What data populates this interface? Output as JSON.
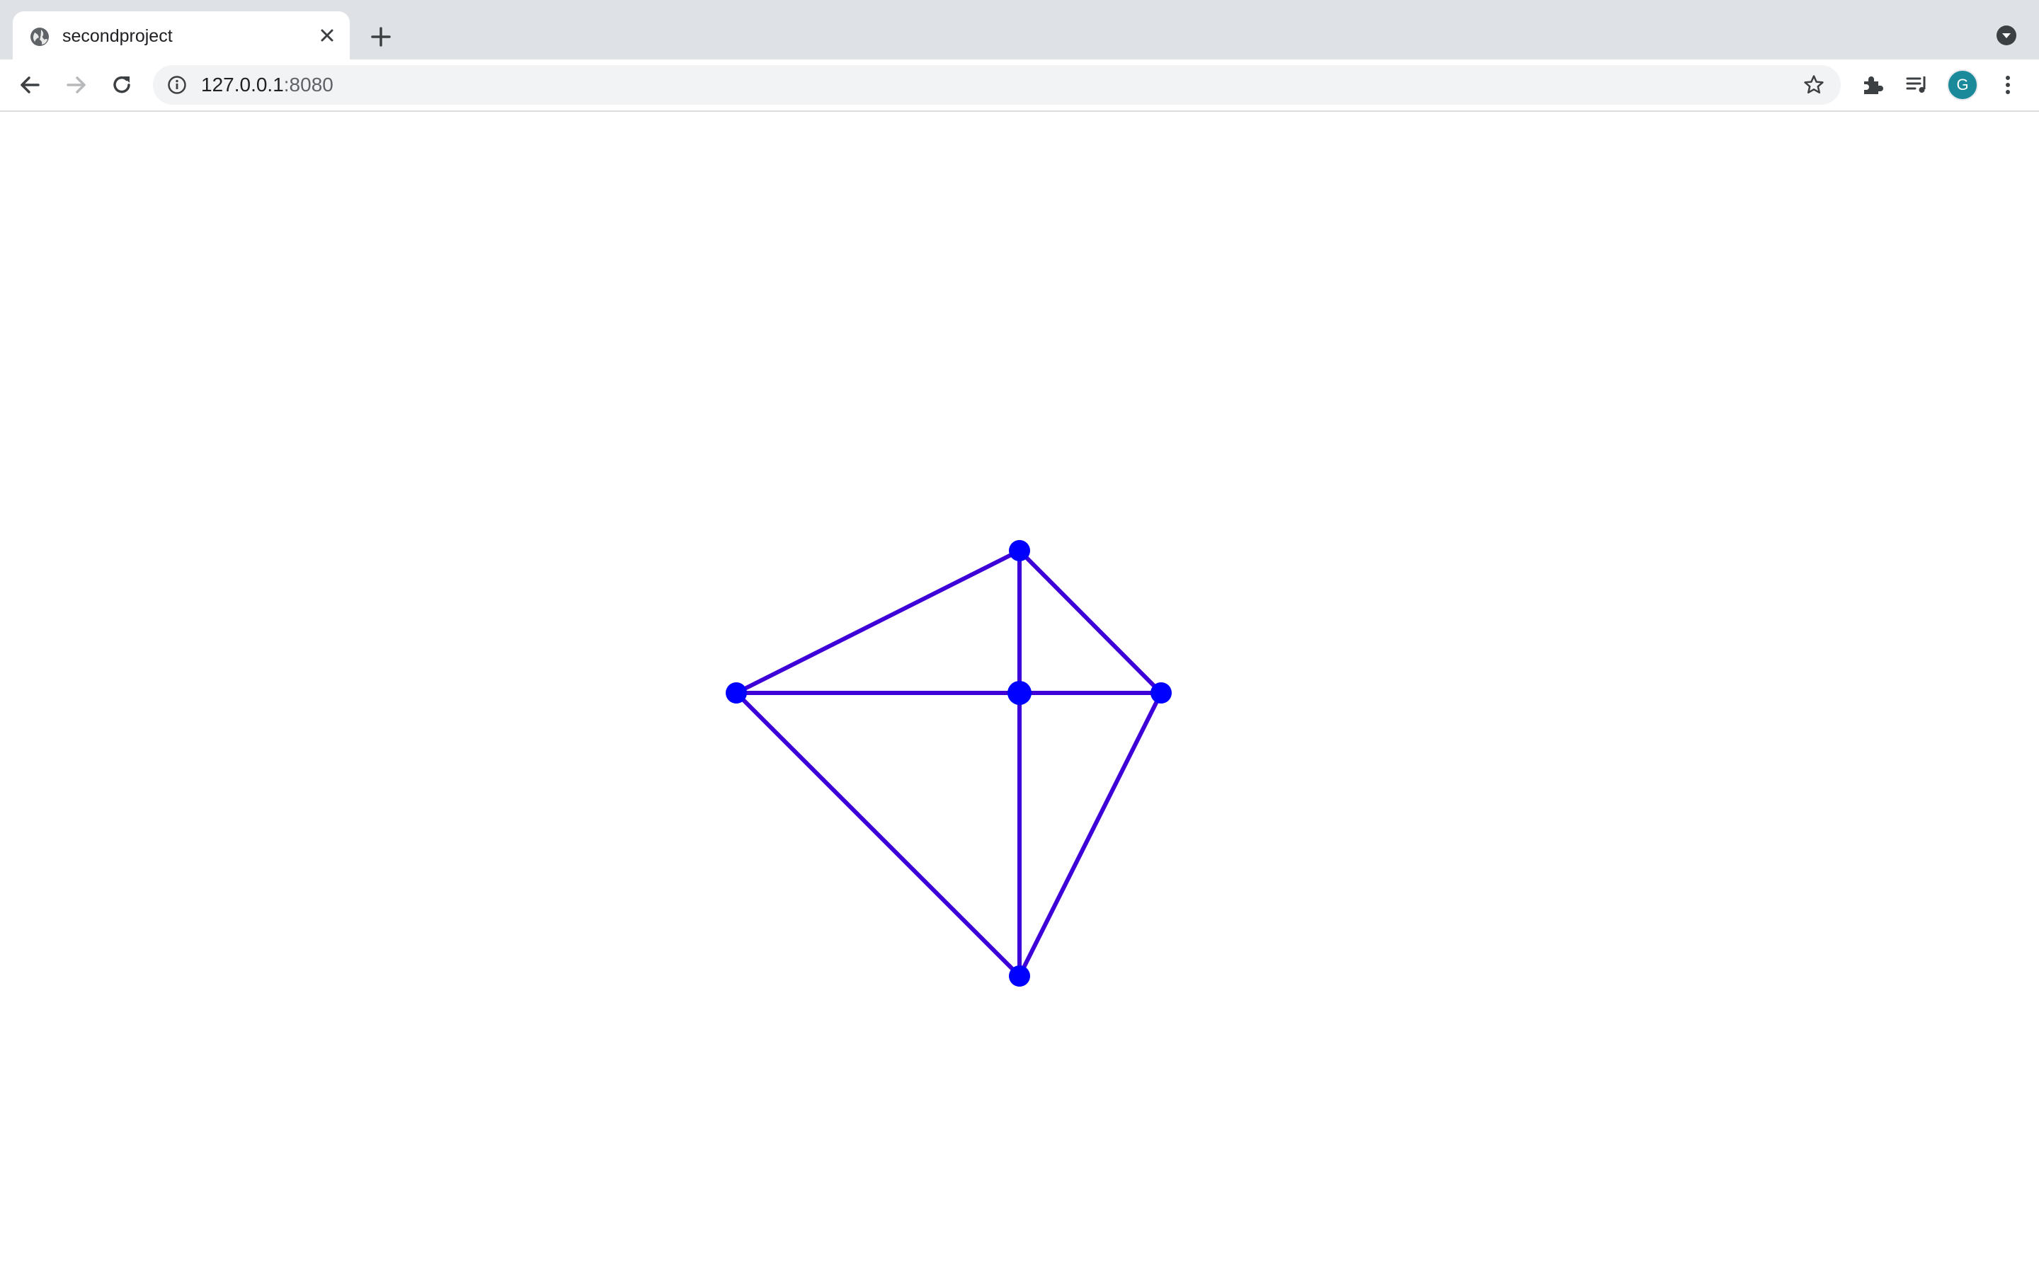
{
  "tab": {
    "title": "secondproject",
    "favicon_icon": "globe-icon",
    "close_icon": "close-icon"
  },
  "tabstrip": {
    "new_tab_icon": "plus-icon",
    "tab_search_icon": "chevron-down-circle-icon"
  },
  "toolbar": {
    "back_icon": "arrow-left-icon",
    "forward_icon": "arrow-right-icon",
    "reload_icon": "reload-icon",
    "address": {
      "info_icon": "info-icon",
      "host": "127.0.0.1",
      "port": ":8080",
      "bookmark_icon": "star-icon"
    },
    "extensions_icon": "puzzle-icon",
    "media_icon": "media-queue-icon",
    "profile_initial": "G",
    "menu_icon": "more-vert-icon"
  },
  "graph": {
    "color_edge": "#3d00d9",
    "color_node": "#0000ff",
    "nodes": [
      {
        "id": "top"
      },
      {
        "id": "left"
      },
      {
        "id": "center"
      },
      {
        "id": "right"
      },
      {
        "id": "bottom"
      }
    ],
    "edges": [
      [
        "top",
        "left"
      ],
      [
        "top",
        "right"
      ],
      [
        "top",
        "center"
      ],
      [
        "left",
        "center"
      ],
      [
        "center",
        "right"
      ],
      [
        "left",
        "bottom"
      ],
      [
        "center",
        "bottom"
      ],
      [
        "right",
        "bottom"
      ]
    ]
  }
}
